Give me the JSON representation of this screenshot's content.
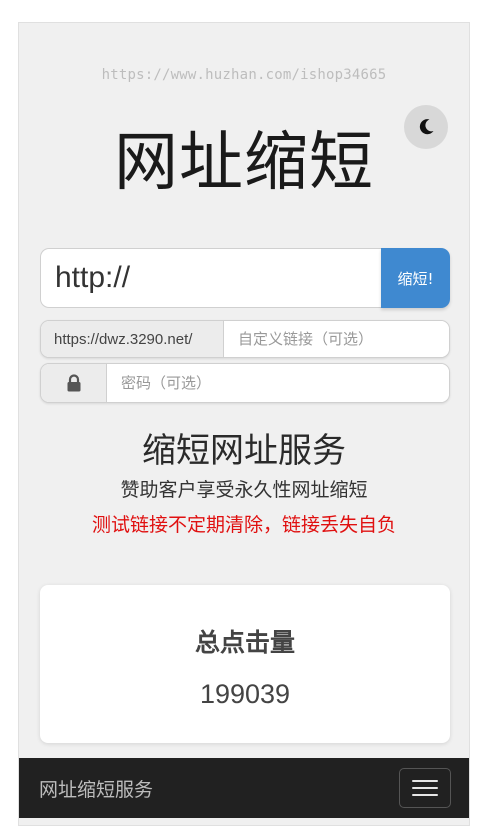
{
  "watermark": "https://www.huzhan.com/ishop34665",
  "title": "网址缩短",
  "url_form": {
    "placeholder": "http://",
    "shorten_label": "缩短!"
  },
  "alias": {
    "prefix": "https://dwz.3290.net/",
    "placeholder": "自定义链接（可选）"
  },
  "password": {
    "icon": "lock-icon",
    "placeholder": "密码（可选）"
  },
  "service": {
    "title": "缩短网址服务",
    "subtitle": "赞助客户享受永久性网址缩短",
    "warning": "测试链接不定期清除，链接丢失自负"
  },
  "stats": {
    "label": "总点击量",
    "value": "199039"
  },
  "navbar": {
    "brand": "网址缩短服务",
    "toggle_icon": "hamburger-menu-icon"
  },
  "colors": {
    "accent": "#3f89d0",
    "warning": "#e01010",
    "navbar": "#212121",
    "background": "#f0f0f0"
  }
}
